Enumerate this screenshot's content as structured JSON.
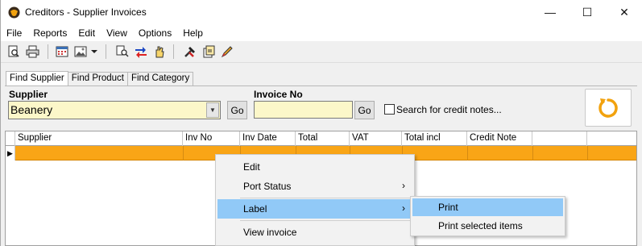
{
  "window": {
    "title": "Creditors - Supplier Invoices",
    "minimize_glyph": "—",
    "maximize_glyph": "☐",
    "close_glyph": "✕"
  },
  "menu": [
    "File",
    "Reports",
    "Edit",
    "View",
    "Options",
    "Help"
  ],
  "toolbar_icons": [
    "print-preview-icon",
    "print-icon",
    "calendar-icon",
    "image-icon",
    "dropdown-arrow-icon",
    "search-document-icon",
    "transfer-icon",
    "hand-icon",
    "tools-icon",
    "export-icon",
    "edit-pen-icon"
  ],
  "tabs": [
    "Find Supplier",
    "Find Product",
    "Find Category"
  ],
  "search": {
    "supplier_label": "Supplier",
    "supplier_value": "Beanery",
    "go_label": "Go",
    "invoice_label": "Invoice No",
    "invoice_value": "",
    "go2_label": "Go",
    "credit_notes_label": "Search for credit notes..."
  },
  "grid": {
    "columns": [
      "Supplier",
      "Inv No",
      "Inv Date",
      "Total",
      "VAT",
      "Total incl",
      "Credit Note",
      ""
    ],
    "selected_row_color": "#f9a516"
  },
  "context_menu": {
    "items": [
      {
        "label": "Edit",
        "has_submenu": false
      },
      {
        "label": "Port Status",
        "has_submenu": true
      },
      {
        "label": "Label",
        "has_submenu": true
      },
      {
        "label": "View invoice",
        "has_submenu": false
      }
    ],
    "submenu_arrow": "›"
  },
  "label_submenu": [
    "Print",
    "Print selected items"
  ],
  "colors": {
    "accent_highlight": "#91c9f7",
    "input_bg": "#fcf7c9",
    "refresh_icon": "#f2a20e"
  }
}
